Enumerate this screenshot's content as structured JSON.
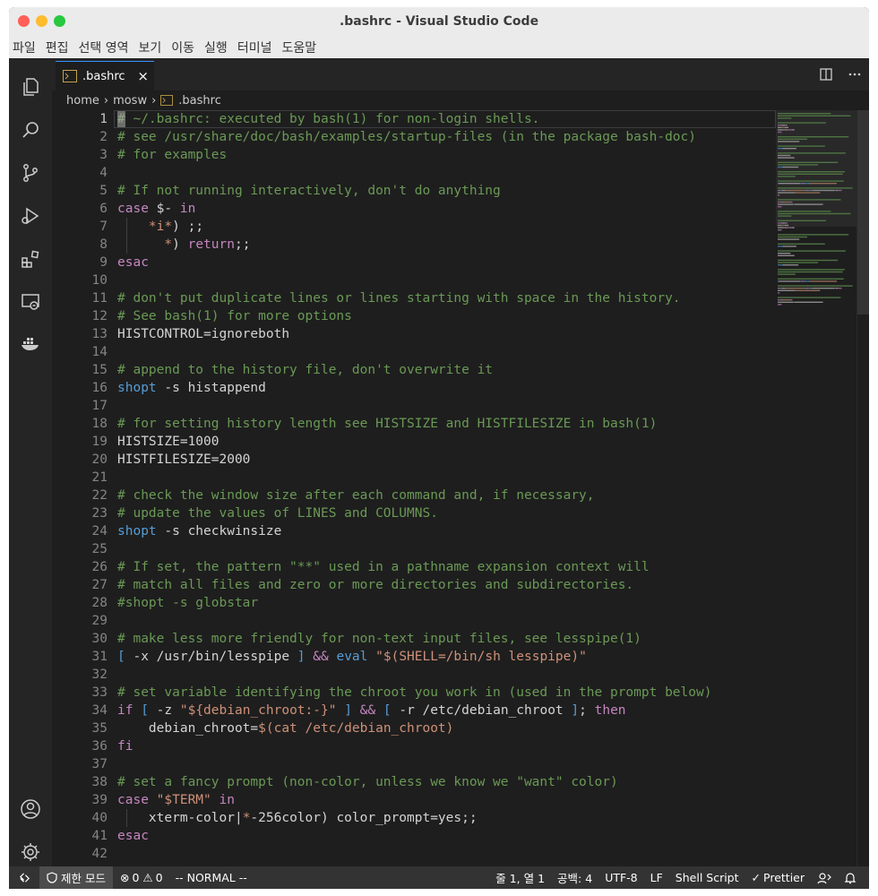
{
  "window": {
    "title": ".bashrc - Visual Studio Code",
    "colors": {
      "close": "#ff5f57",
      "minimize": "#febc2e",
      "maximize": "#28c840",
      "accent": "#3794ff",
      "statusbar": "#333333"
    }
  },
  "menu": [
    "파일",
    "편집",
    "선택 영역",
    "보기",
    "이동",
    "실행",
    "터미널",
    "도움말"
  ],
  "activity_bar": [
    "explorer-icon",
    "search-icon",
    "source-control-icon",
    "run-debug-icon",
    "extensions-icon",
    "remote-explorer-icon",
    "docker-icon",
    "account-icon",
    "manage-gear-icon"
  ],
  "tab": {
    "label": ".bashrc",
    "close": "×",
    "icon": "terminal-file-icon"
  },
  "tab_actions": [
    "split-editor-icon",
    "more-actions-icon"
  ],
  "breadcrumb": {
    "parts": [
      "home",
      "mosw"
    ],
    "file": ".bashrc",
    "separator": "›"
  },
  "editor": {
    "current_line": 1,
    "lines": [
      {
        "n": "1",
        "t": [
          [
            "c",
            "# ~/.bashrc: executed by bash(1) for non-login shells."
          ]
        ]
      },
      {
        "n": "2",
        "t": [
          [
            "c",
            "# see /usr/share/doc/bash/examples/startup-files (in the package bash-doc)"
          ]
        ]
      },
      {
        "n": "3",
        "t": [
          [
            "c",
            "# for examples"
          ]
        ]
      },
      {
        "n": "4",
        "t": []
      },
      {
        "n": "5",
        "t": [
          [
            "c",
            "# If not running interactively, don't do anything"
          ]
        ]
      },
      {
        "n": "6",
        "t": [
          [
            "p",
            "case"
          ],
          [
            "o",
            " $- "
          ],
          [
            "p",
            "in"
          ]
        ]
      },
      {
        "n": "7",
        "t": [
          [
            "o",
            "    "
          ],
          [
            "s",
            "*i*"
          ],
          [
            "o",
            ") ;;"
          ]
        ]
      },
      {
        "n": "8",
        "t": [
          [
            "o",
            "      "
          ],
          [
            "s",
            "*"
          ],
          [
            "o",
            ") "
          ],
          [
            "p",
            "return"
          ],
          [
            "o",
            ";;"
          ]
        ]
      },
      {
        "n": "9",
        "t": [
          [
            "p",
            "esac"
          ]
        ]
      },
      {
        "n": "10",
        "t": []
      },
      {
        "n": "11",
        "t": [
          [
            "c",
            "# don't put duplicate lines or lines starting with space in the history."
          ]
        ]
      },
      {
        "n": "12",
        "t": [
          [
            "c",
            "# See bash(1) for more options"
          ]
        ]
      },
      {
        "n": "13",
        "t": [
          [
            "o",
            "HISTCONTROL=ignoreboth"
          ]
        ]
      },
      {
        "n": "14",
        "t": []
      },
      {
        "n": "15",
        "t": [
          [
            "c",
            "# append to the history file, don't overwrite it"
          ]
        ]
      },
      {
        "n": "16",
        "t": [
          [
            "k",
            "shopt"
          ],
          [
            "o",
            " -s histappend"
          ]
        ]
      },
      {
        "n": "17",
        "t": []
      },
      {
        "n": "18",
        "t": [
          [
            "c",
            "# for setting history length see HISTSIZE and HISTFILESIZE in bash(1)"
          ]
        ]
      },
      {
        "n": "19",
        "t": [
          [
            "o",
            "HISTSIZE=1000"
          ]
        ]
      },
      {
        "n": "20",
        "t": [
          [
            "o",
            "HISTFILESIZE=2000"
          ]
        ]
      },
      {
        "n": "21",
        "t": []
      },
      {
        "n": "22",
        "t": [
          [
            "c",
            "# check the window size after each command and, if necessary,"
          ]
        ]
      },
      {
        "n": "23",
        "t": [
          [
            "c",
            "# update the values of LINES and COLUMNS."
          ]
        ]
      },
      {
        "n": "24",
        "t": [
          [
            "k",
            "shopt"
          ],
          [
            "o",
            " -s checkwinsize"
          ]
        ]
      },
      {
        "n": "25",
        "t": []
      },
      {
        "n": "26",
        "t": [
          [
            "c",
            "# If set, the pattern \"**\" used in a pathname expansion context will"
          ]
        ]
      },
      {
        "n": "27",
        "t": [
          [
            "c",
            "# match all files and zero or more directories and subdirectories."
          ]
        ]
      },
      {
        "n": "28",
        "t": [
          [
            "c",
            "#shopt -s globstar"
          ]
        ]
      },
      {
        "n": "29",
        "t": []
      },
      {
        "n": "30",
        "t": [
          [
            "c",
            "# make less more friendly for non-text input files, see lesspipe(1)"
          ]
        ]
      },
      {
        "n": "31",
        "t": [
          [
            "k",
            "["
          ],
          [
            "o",
            " -x /usr/bin/lesspipe "
          ],
          [
            "k",
            "]"
          ],
          [
            "o",
            " "
          ],
          [
            "p",
            "&&"
          ],
          [
            "o",
            " "
          ],
          [
            "k",
            "eval"
          ],
          [
            "o",
            " "
          ],
          [
            "s",
            "\"$(SHELL=/bin/sh lesspipe)\""
          ]
        ]
      },
      {
        "n": "32",
        "t": []
      },
      {
        "n": "33",
        "t": [
          [
            "c",
            "# set variable identifying the chroot you work in (used in the prompt below)"
          ]
        ]
      },
      {
        "n": "34",
        "t": [
          [
            "p",
            "if"
          ],
          [
            "o",
            " "
          ],
          [
            "k",
            "["
          ],
          [
            "o",
            " -z "
          ],
          [
            "s",
            "\"${debian_chroot:-}\""
          ],
          [
            "o",
            " "
          ],
          [
            "k",
            "]"
          ],
          [
            "o",
            " "
          ],
          [
            "p",
            "&&"
          ],
          [
            "o",
            " "
          ],
          [
            "k",
            "["
          ],
          [
            "o",
            " -r /etc/debian_chroot "
          ],
          [
            "k",
            "]"
          ],
          [
            "o",
            "; "
          ],
          [
            "p",
            "then"
          ]
        ]
      },
      {
        "n": "35",
        "t": [
          [
            "o",
            "    debian_chroot="
          ],
          [
            "s",
            "$(cat /etc/debian_chroot)"
          ]
        ]
      },
      {
        "n": "36",
        "t": [
          [
            "p",
            "fi"
          ]
        ]
      },
      {
        "n": "37",
        "t": []
      },
      {
        "n": "38",
        "t": [
          [
            "c",
            "# set a fancy prompt (non-color, unless we know we \"want\" color)"
          ]
        ]
      },
      {
        "n": "39",
        "t": [
          [
            "p",
            "case"
          ],
          [
            "o",
            " "
          ],
          [
            "s",
            "\"$TERM\""
          ],
          [
            "o",
            " "
          ],
          [
            "p",
            "in"
          ]
        ]
      },
      {
        "n": "40",
        "t": [
          [
            "o",
            "    xterm-color|"
          ],
          [
            "s",
            "*"
          ],
          [
            "o",
            "-256color) color_prompt=yes;;"
          ]
        ]
      },
      {
        "n": "41",
        "t": [
          [
            "p",
            "esac"
          ]
        ]
      },
      {
        "n": "42",
        "t": []
      }
    ]
  },
  "statusbar": {
    "remote_icon": "remote-indicator-icon",
    "restricted_mode": "제한 모드",
    "errors": "0",
    "warnings": "0",
    "vim_mode": "-- NORMAL --",
    "position": "줄 1, 열 1",
    "spaces": "공백: 4",
    "encoding": "UTF-8",
    "eol": "LF",
    "language": "Shell Script",
    "prettier": "Prettier"
  }
}
